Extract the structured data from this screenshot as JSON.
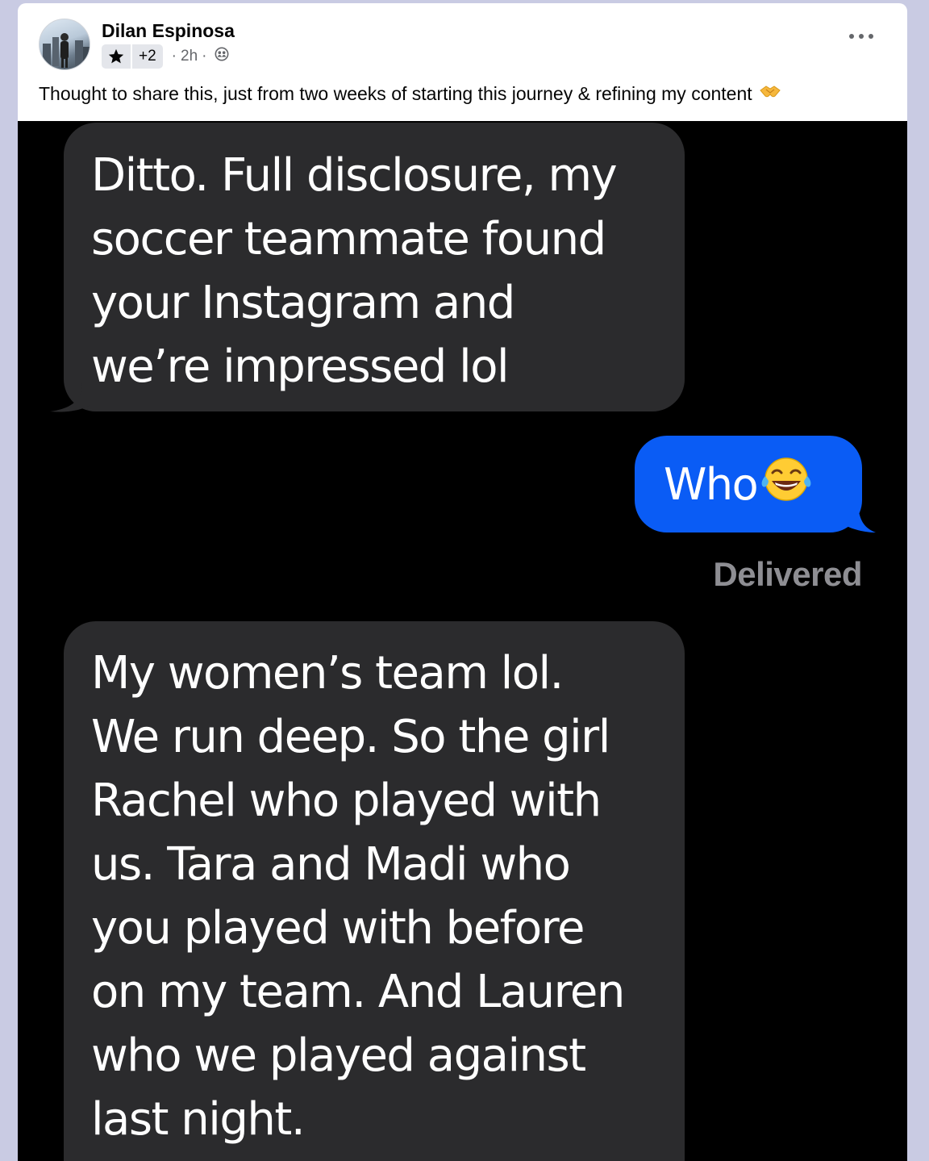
{
  "post": {
    "author": "Dilan Espinosa",
    "badge_count": "+2",
    "time": "2h",
    "separator": "·",
    "caption": "Thought to share this, just from two weeks of starting this journey & refining my content",
    "caption_emoji_icon": "handshake-icon",
    "privacy_icon": "friends-icon",
    "badge_icon": "star-icon"
  },
  "conversation": {
    "message_1_lines": [
      "Ditto. Full disclosure, my",
      "soccer teammate found",
      "your Instagram and",
      "we’re impressed lol"
    ],
    "message_2_text": "Who",
    "message_2_emoji_icon": "tears-of-joy-icon",
    "status": "Delivered",
    "message_3_lines": [
      "My women’s team lol.",
      "We run deep. So the girl",
      "Rachel who played with",
      "us. Tara and Madi who",
      "you played with before",
      "on my team. And Lauren",
      "who we played against",
      "last night."
    ]
  },
  "colors": {
    "sent_bubble": "#0a5cf5",
    "received_bubble": "#2b2b2d",
    "chat_background": "#000000",
    "page_background": "#c9cbe3"
  }
}
